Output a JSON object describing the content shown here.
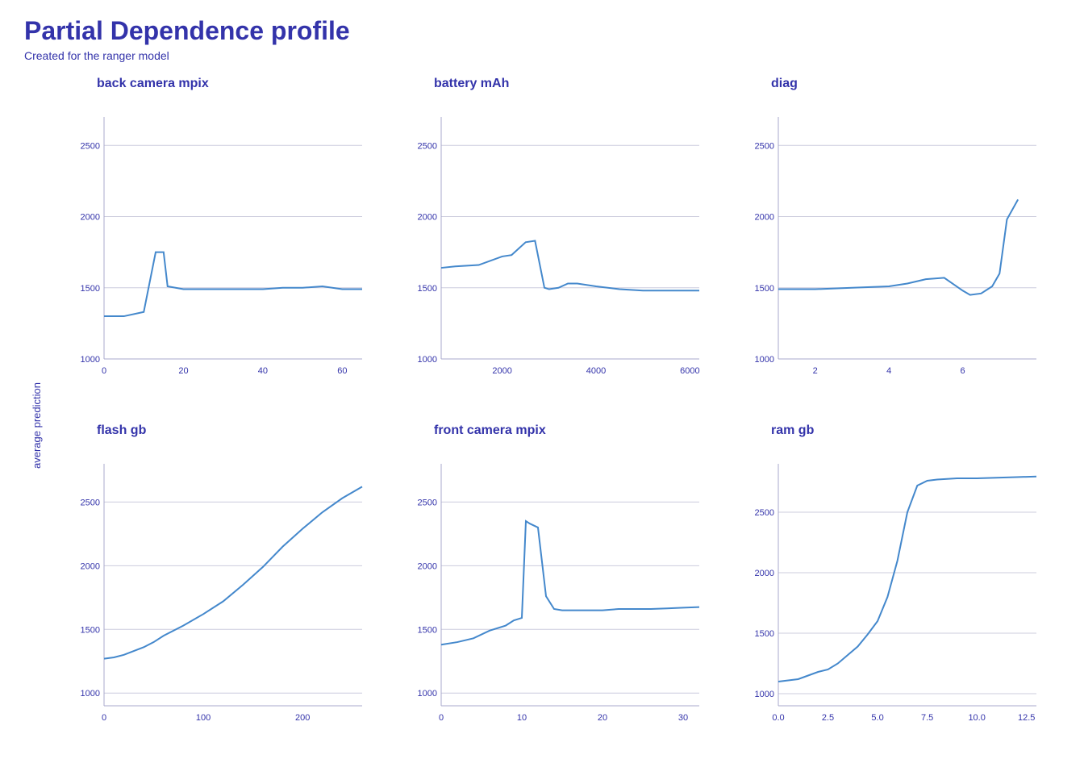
{
  "title": "Partial Dependence profile",
  "subtitle": "Created for the ranger model",
  "colors": {
    "primary": "#3333aa",
    "line": "#4488cc",
    "gridline": "#ccccdd",
    "axis_text": "#3333aa"
  },
  "charts": [
    {
      "id": "back-camera-mpix",
      "label": "back  camera  mpix",
      "row": 0,
      "col": 0,
      "x_ticks": [
        "0",
        "20",
        "40",
        "60"
      ],
      "y_ticks": [
        "1000",
        "1500",
        "2000",
        "2500"
      ],
      "x_min": 0,
      "x_max": 65,
      "y_min": 1000,
      "y_max": 2700,
      "points": [
        [
          0,
          1300
        ],
        [
          5,
          1300
        ],
        [
          10,
          1330
        ],
        [
          13,
          1750
        ],
        [
          15,
          1750
        ],
        [
          16,
          1510
        ],
        [
          20,
          1490
        ],
        [
          25,
          1490
        ],
        [
          30,
          1490
        ],
        [
          35,
          1490
        ],
        [
          40,
          1490
        ],
        [
          45,
          1500
        ],
        [
          50,
          1500
        ],
        [
          55,
          1510
        ],
        [
          60,
          1490
        ],
        [
          65,
          1490
        ]
      ]
    },
    {
      "id": "battery-mah",
      "label": "battery  mAh",
      "row": 0,
      "col": 1,
      "x_ticks": [
        "2000",
        "4000",
        "6000"
      ],
      "y_ticks": [
        "1000",
        "1500",
        "2000",
        "2500"
      ],
      "x_min": 700,
      "x_max": 6200,
      "y_min": 1000,
      "y_max": 2700,
      "points": [
        [
          700,
          1640
        ],
        [
          1000,
          1650
        ],
        [
          1500,
          1660
        ],
        [
          2000,
          1720
        ],
        [
          2200,
          1730
        ],
        [
          2500,
          1820
        ],
        [
          2700,
          1830
        ],
        [
          2900,
          1500
        ],
        [
          3000,
          1490
        ],
        [
          3200,
          1500
        ],
        [
          3400,
          1530
        ],
        [
          3600,
          1530
        ],
        [
          4000,
          1510
        ],
        [
          4500,
          1490
        ],
        [
          5000,
          1480
        ],
        [
          5500,
          1480
        ],
        [
          6000,
          1480
        ],
        [
          6200,
          1480
        ]
      ]
    },
    {
      "id": "diag",
      "label": "diag",
      "row": 0,
      "col": 2,
      "x_ticks": [
        "2",
        "4",
        "6"
      ],
      "y_ticks": [
        "1000",
        "1500",
        "2000",
        "2500"
      ],
      "x_min": 1,
      "x_max": 8,
      "y_min": 1000,
      "y_max": 2700,
      "points": [
        [
          1,
          1490
        ],
        [
          1.5,
          1490
        ],
        [
          2,
          1490
        ],
        [
          3,
          1500
        ],
        [
          4,
          1510
        ],
        [
          4.5,
          1530
        ],
        [
          5,
          1560
        ],
        [
          5.5,
          1570
        ],
        [
          6,
          1480
        ],
        [
          6.2,
          1450
        ],
        [
          6.5,
          1460
        ],
        [
          6.8,
          1510
        ],
        [
          7,
          1600
        ],
        [
          7.2,
          1980
        ],
        [
          7.5,
          2120
        ]
      ]
    },
    {
      "id": "flash-gb",
      "label": "flash  gb",
      "row": 1,
      "col": 0,
      "x_ticks": [
        "0",
        "100",
        "200"
      ],
      "y_ticks": [
        "1000",
        "1500",
        "2000",
        "2500"
      ],
      "x_min": 0,
      "x_max": 260,
      "y_min": 900,
      "y_max": 2800,
      "points": [
        [
          0,
          1270
        ],
        [
          10,
          1280
        ],
        [
          20,
          1300
        ],
        [
          30,
          1330
        ],
        [
          40,
          1360
        ],
        [
          50,
          1400
        ],
        [
          60,
          1450
        ],
        [
          80,
          1530
        ],
        [
          100,
          1620
        ],
        [
          120,
          1720
        ],
        [
          140,
          1850
        ],
        [
          160,
          1990
        ],
        [
          180,
          2150
        ],
        [
          200,
          2290
        ],
        [
          220,
          2420
        ],
        [
          240,
          2530
        ],
        [
          260,
          2620
        ]
      ]
    },
    {
      "id": "front-camera-mpix",
      "label": "front  camera  mpix",
      "row": 1,
      "col": 1,
      "x_ticks": [
        "0",
        "10",
        "20",
        "30"
      ],
      "y_ticks": [
        "1000",
        "1500",
        "2000",
        "2500"
      ],
      "x_min": 0,
      "x_max": 32,
      "y_min": 900,
      "y_max": 2800,
      "points": [
        [
          0,
          1380
        ],
        [
          2,
          1400
        ],
        [
          4,
          1430
        ],
        [
          6,
          1490
        ],
        [
          8,
          1530
        ],
        [
          9,
          1570
        ],
        [
          10,
          1590
        ],
        [
          10.5,
          2350
        ],
        [
          11,
          2330
        ],
        [
          12,
          2300
        ],
        [
          13,
          1760
        ],
        [
          14,
          1660
        ],
        [
          15,
          1650
        ],
        [
          16,
          1650
        ],
        [
          18,
          1650
        ],
        [
          20,
          1650
        ],
        [
          22,
          1660
        ],
        [
          24,
          1660
        ],
        [
          26,
          1660
        ],
        [
          28,
          1665
        ],
        [
          30,
          1670
        ],
        [
          32,
          1675
        ]
      ]
    },
    {
      "id": "ram-gb",
      "label": "ram  gb",
      "row": 1,
      "col": 2,
      "x_ticks": [
        "0.0",
        "2.5",
        "5.0",
        "7.5",
        "10.0",
        "12.5"
      ],
      "y_ticks": [
        "1000",
        "1500",
        "2000",
        "2500"
      ],
      "x_min": 0,
      "x_max": 13,
      "y_min": 900,
      "y_max": 2900,
      "points": [
        [
          0,
          1100
        ],
        [
          0.5,
          1110
        ],
        [
          1,
          1120
        ],
        [
          1.5,
          1150
        ],
        [
          2,
          1180
        ],
        [
          2.5,
          1200
        ],
        [
          3,
          1250
        ],
        [
          3.5,
          1320
        ],
        [
          4,
          1390
        ],
        [
          4.5,
          1490
        ],
        [
          5,
          1600
        ],
        [
          5.5,
          1800
        ],
        [
          6,
          2100
        ],
        [
          6.5,
          2500
        ],
        [
          7,
          2720
        ],
        [
          7.5,
          2760
        ],
        [
          8,
          2770
        ],
        [
          9,
          2780
        ],
        [
          10,
          2780
        ],
        [
          11,
          2785
        ],
        [
          12,
          2790
        ],
        [
          13,
          2795
        ]
      ]
    }
  ],
  "y_axis_label": "average prediction"
}
